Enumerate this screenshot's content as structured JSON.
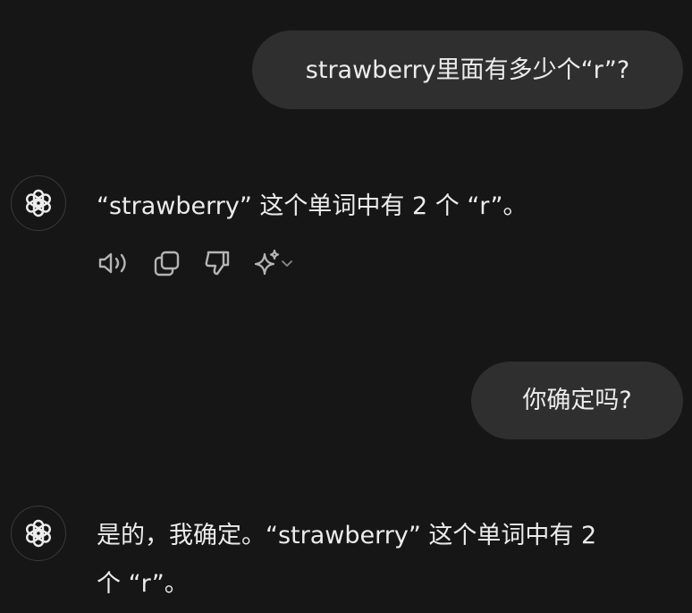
{
  "messages": [
    {
      "role": "user",
      "text": "strawberry里面有多少个“r”?"
    },
    {
      "role": "assistant",
      "icon": "openai-logo-icon",
      "text": "“strawberry” 这个单词中有 2 个 “r”。"
    },
    {
      "role": "user",
      "text": "你确定吗?"
    },
    {
      "role": "assistant",
      "icon": "openai-logo-icon",
      "line1": "是的，我确定。“strawberry” 这个单词中有 2",
      "line2": "个 “r”。"
    }
  ],
  "actions": [
    "read-aloud-icon",
    "copy-icon",
    "thumbs-down-icon",
    "sparkle-model-icon",
    "chevron-down-icon"
  ],
  "colors": {
    "background": "#161616",
    "user_bubble": "#2f2f2f",
    "text": "#ececec",
    "icon": "#b4b4b4"
  }
}
